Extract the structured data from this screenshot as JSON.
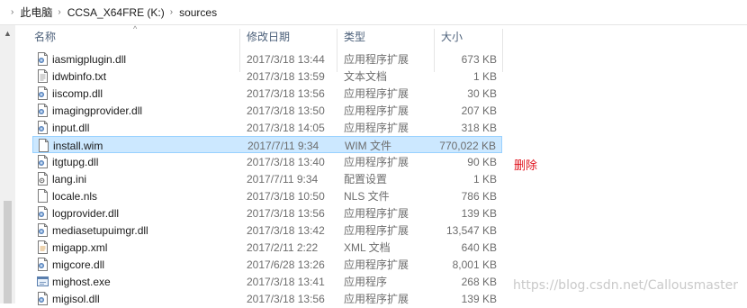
{
  "breadcrumb": {
    "segments": [
      "此电脑",
      "CCSA_X64FRE (K:)",
      "sources"
    ]
  },
  "columns": {
    "name": "名称",
    "date": "修改日期",
    "type": "类型",
    "size": "大小"
  },
  "files": [
    {
      "name": "iasmigplugin.dll",
      "date": "2017/3/18 13:44",
      "type": "应用程序扩展",
      "size": "673 KB",
      "icon": "dll-icon"
    },
    {
      "name": "idwbinfo.txt",
      "date": "2017/3/18 13:59",
      "type": "文本文档",
      "size": "1 KB",
      "icon": "text-file-icon"
    },
    {
      "name": "iiscomp.dll",
      "date": "2017/3/18 13:56",
      "type": "应用程序扩展",
      "size": "30 KB",
      "icon": "dll-icon"
    },
    {
      "name": "imagingprovider.dll",
      "date": "2017/3/18 13:50",
      "type": "应用程序扩展",
      "size": "207 KB",
      "icon": "dll-icon"
    },
    {
      "name": "input.dll",
      "date": "2017/3/18 14:05",
      "type": "应用程序扩展",
      "size": "318 KB",
      "icon": "dll-icon"
    },
    {
      "name": "install.wim",
      "date": "2017/7/11 9:34",
      "type": "WIM 文件",
      "size": "770,022 KB",
      "icon": "blank-file-icon",
      "selected": true
    },
    {
      "name": "itgtupg.dll",
      "date": "2017/3/18 13:40",
      "type": "应用程序扩展",
      "size": "90 KB",
      "icon": "dll-icon"
    },
    {
      "name": "lang.ini",
      "date": "2017/7/11 9:34",
      "type": "配置设置",
      "size": "1 KB",
      "icon": "settings-file-icon"
    },
    {
      "name": "locale.nls",
      "date": "2017/3/18 10:50",
      "type": "NLS 文件",
      "size": "786 KB",
      "icon": "blank-file-icon"
    },
    {
      "name": "logprovider.dll",
      "date": "2017/3/18 13:56",
      "type": "应用程序扩展",
      "size": "139 KB",
      "icon": "dll-icon"
    },
    {
      "name": "mediasetupuimgr.dll",
      "date": "2017/3/18 13:42",
      "type": "应用程序扩展",
      "size": "13,547 KB",
      "icon": "dll-icon"
    },
    {
      "name": "migapp.xml",
      "date": "2017/2/11 2:22",
      "type": "XML 文档",
      "size": "640 KB",
      "icon": "xml-file-icon"
    },
    {
      "name": "migcore.dll",
      "date": "2017/6/28 13:26",
      "type": "应用程序扩展",
      "size": "8,001 KB",
      "icon": "dll-icon"
    },
    {
      "name": "mighost.exe",
      "date": "2017/3/18 13:41",
      "type": "应用程序",
      "size": "268 KB",
      "icon": "exe-icon"
    },
    {
      "name": "migisol.dll",
      "date": "2017/3/18 13:56",
      "type": "应用程序扩展",
      "size": "139 KB",
      "icon": "dll-icon"
    }
  ],
  "annotation": "删除",
  "watermark": "https://blog.csdn.net/Callousmaster",
  "colors": {
    "selection_bg": "#cce8ff",
    "selection_border": "#99d1ff",
    "header_text": "#4c607a",
    "annotation_red": "#e0141e"
  }
}
